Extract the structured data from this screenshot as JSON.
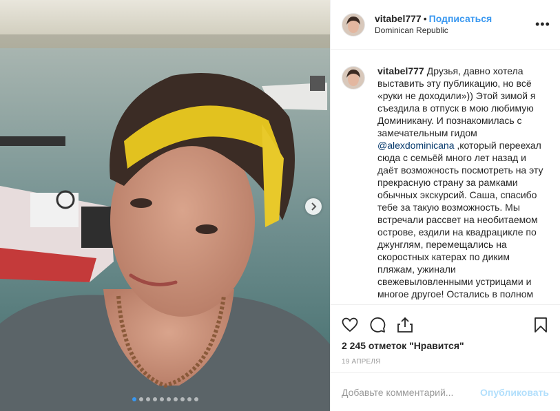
{
  "post": {
    "username": "vitabel777",
    "separator": "•",
    "follow_label": "Подписаться",
    "location": "Dominican Republic",
    "more_icon": "more-options-icon",
    "caption_part1": "Друзья, давно хотела выставить эту публикацию, но всё «руки не доходили»)) Этой зимой я съездила в отпуск в мою любимую Доминикану. И познакомилась с замечательным гидом ",
    "mention": "@alexdominicana",
    "caption_part2": " ,который переехал сюда с семьёй много лет назад и даёт возможность посмотреть на эту прекрасную страну за рамками обычных экскурсий. Саша, спасибо тебе за такую возможность. Мы встречали рассвет на необитаемом острове, ездили на квадрацикле по джунглям, перемещались на скоростных катерах по диким пляжам, ужинали свежевыловленными устрицами и многое другое! Остались в полном",
    "likes": "2 245 отметок \"Нравится\"",
    "date": "19 апреля",
    "comment_placeholder": "Добавьте комментарий...",
    "post_button": "Опубликовать"
  },
  "carousel": {
    "total": 10,
    "active_index": 0
  },
  "icons": [
    "heart-icon",
    "comment-icon",
    "share-icon",
    "bookmark-icon",
    "chevron-right-icon"
  ],
  "colors": {
    "accent": "#3897f0",
    "mention": "#003569",
    "post_disabled": "#b2dffc",
    "border": "#efefef",
    "muted": "#999999"
  }
}
